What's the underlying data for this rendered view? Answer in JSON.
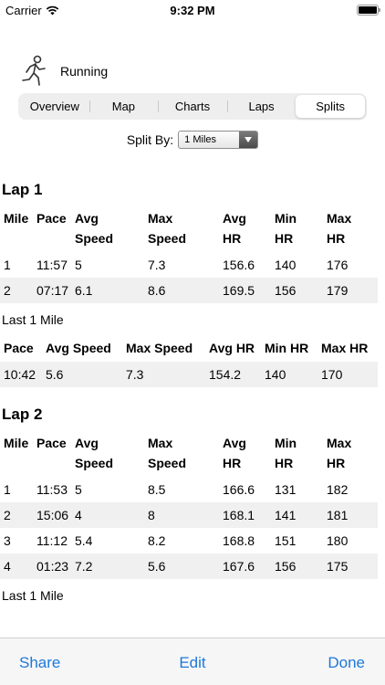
{
  "status": {
    "carrier": "Carrier",
    "time": "9:32 PM"
  },
  "activity": {
    "label": "Running"
  },
  "tabs": [
    {
      "label": "Overview",
      "selected": false
    },
    {
      "label": "Map",
      "selected": false
    },
    {
      "label": "Charts",
      "selected": false
    },
    {
      "label": "Laps",
      "selected": false
    },
    {
      "label": "Splits",
      "selected": true
    }
  ],
  "split": {
    "label": "Split By:",
    "value": "1 Miles"
  },
  "laps": [
    {
      "title": "Lap 1",
      "headers": [
        [
          "Mile"
        ],
        [
          "Pace"
        ],
        [
          "Avg",
          "Speed"
        ],
        [
          "Max",
          "Speed"
        ],
        [
          "Avg",
          "HR"
        ],
        [
          "Min",
          "HR"
        ],
        [
          "Max",
          "HR"
        ]
      ],
      "rows": [
        [
          "1",
          "11:57",
          "5",
          "7.3",
          "156.6",
          "140",
          "176"
        ],
        [
          "2",
          "07:17",
          "6.1",
          "8.6",
          "169.5",
          "156",
          "179"
        ]
      ],
      "last_label": "Last 1 Mile",
      "last_headers": [
        "Pace",
        "Avg Speed",
        "Max Speed",
        "Avg HR",
        "Min HR",
        "Max HR"
      ],
      "last_row": [
        "10:42",
        "5.6",
        "7.3",
        "154.2",
        "140",
        "170"
      ]
    },
    {
      "title": "Lap 2",
      "headers": [
        [
          "Mile"
        ],
        [
          "Pace"
        ],
        [
          "Avg",
          "Speed"
        ],
        [
          "Max",
          "Speed"
        ],
        [
          "Avg",
          "HR"
        ],
        [
          "Min",
          "HR"
        ],
        [
          "Max",
          "HR"
        ]
      ],
      "rows": [
        [
          "1",
          "11:53",
          "5",
          "8.5",
          "166.6",
          "131",
          "182"
        ],
        [
          "2",
          "15:06",
          "4",
          "8",
          "168.1",
          "141",
          "181"
        ],
        [
          "3",
          "11:12",
          "5.4",
          "8.2",
          "168.8",
          "151",
          "180"
        ],
        [
          "4",
          "01:23",
          "7.2",
          "5.6",
          "167.6",
          "156",
          "175"
        ]
      ],
      "last_label": "Last 1 Mile"
    }
  ],
  "toolbar": {
    "share": "Share",
    "edit": "Edit",
    "done": "Done"
  },
  "colors": {
    "accent": "#1e78d8",
    "stripe": "#f0f0f1"
  }
}
